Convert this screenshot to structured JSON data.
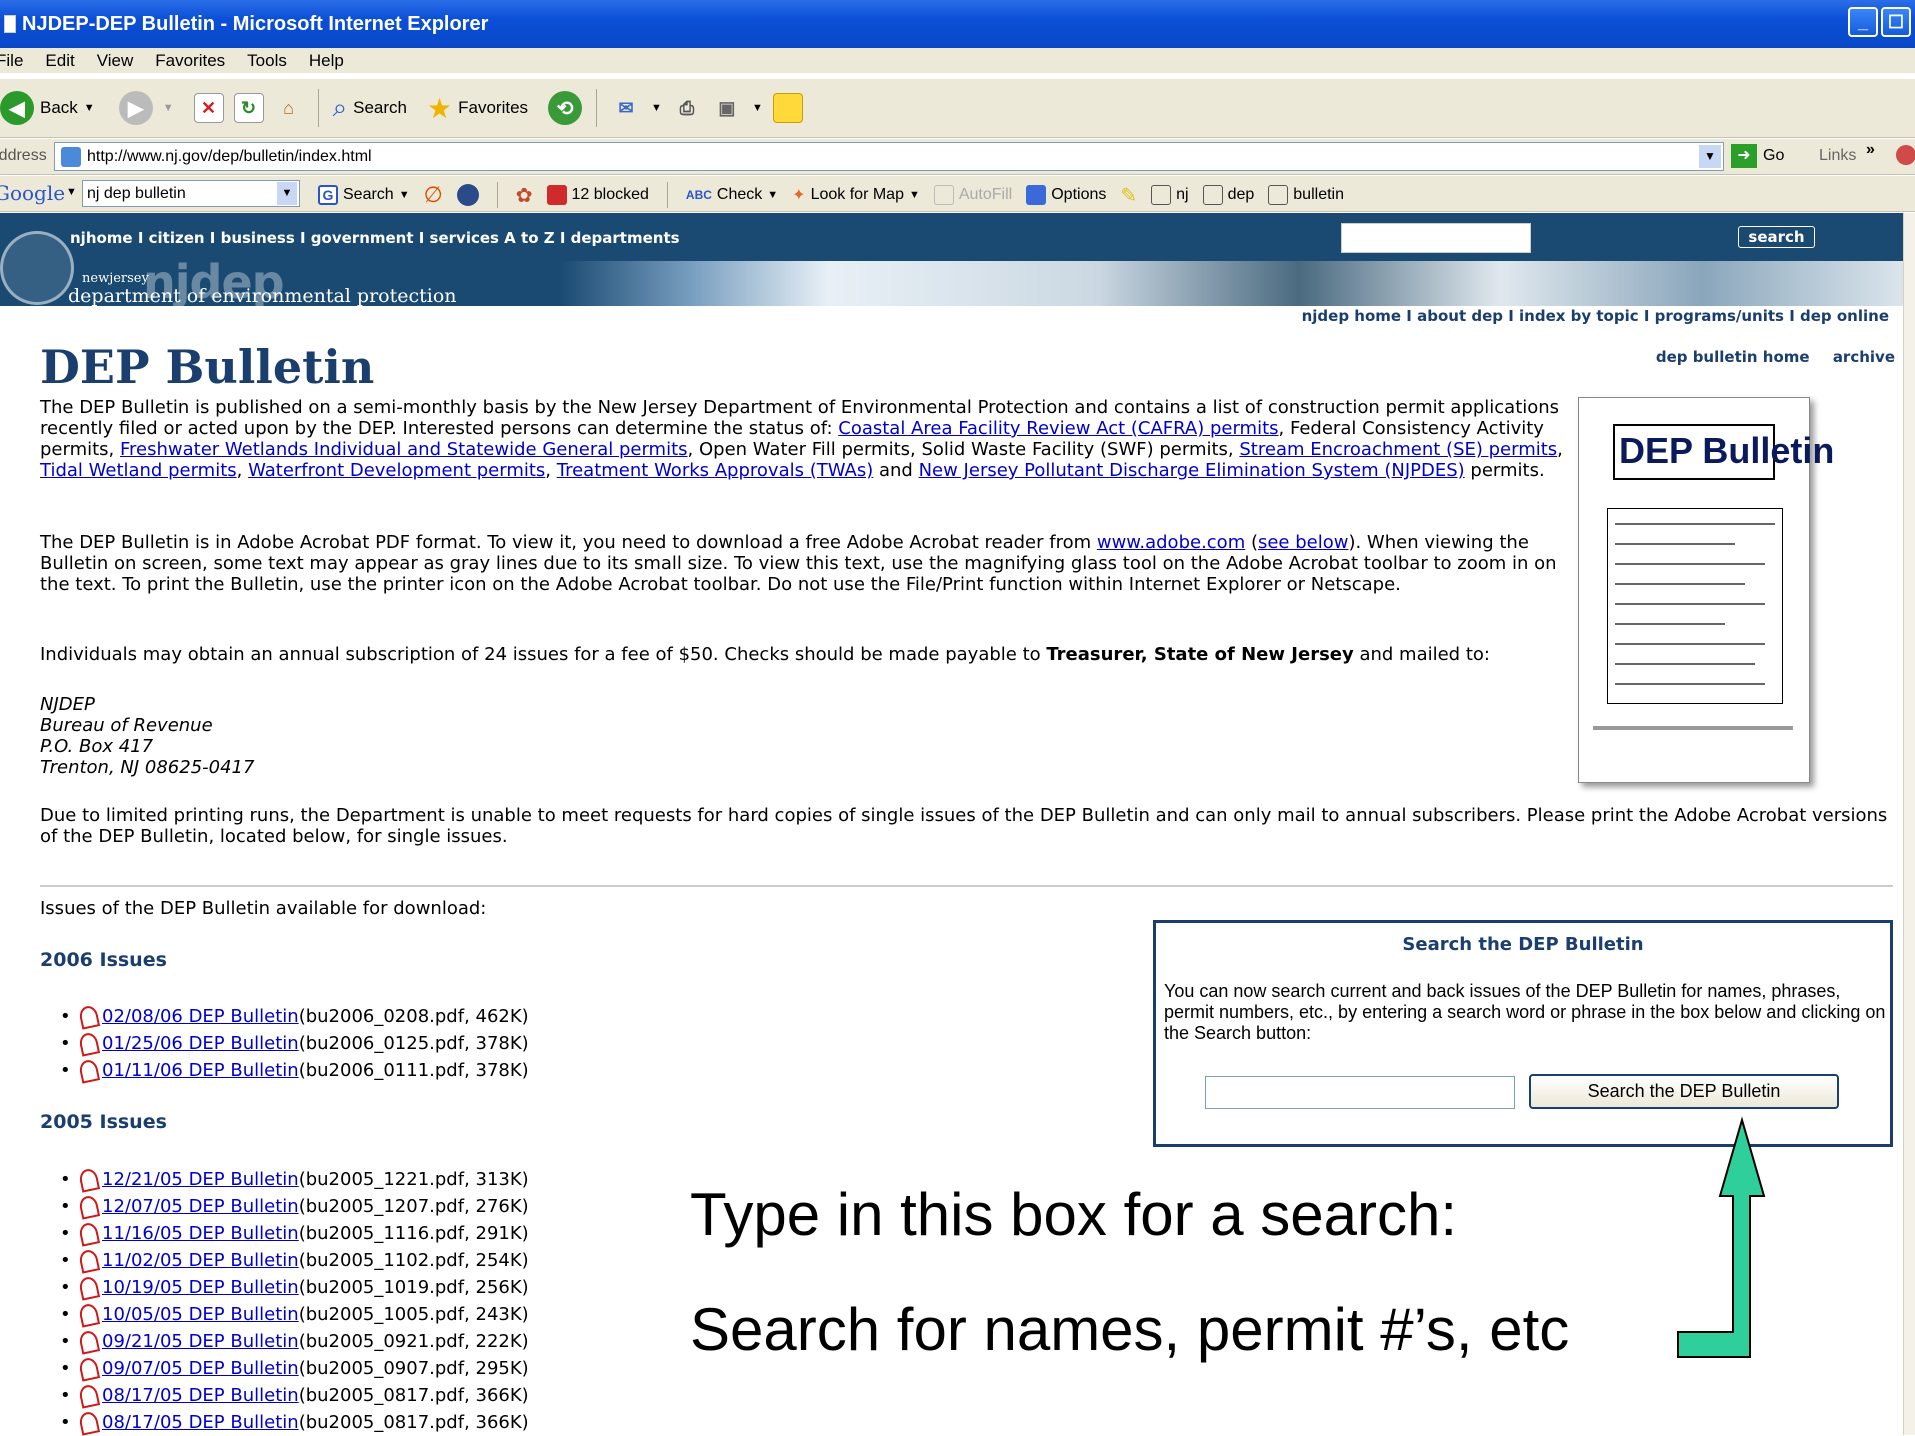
{
  "window": {
    "title": "NJDEP-DEP Bulletin - Microsoft Internet Explorer"
  },
  "menu": [
    "File",
    "Edit",
    "View",
    "Favorites",
    "Tools",
    "Help"
  ],
  "toolbar": {
    "back": "Back",
    "search": "Search",
    "favorites": "Favorites"
  },
  "address": {
    "label": "Address",
    "url": "http://www.nj.gov/dep/bulletin/index.html",
    "go": "Go",
    "links": "Links"
  },
  "google": {
    "logo": "Google",
    "query": "nj dep bulletin",
    "search": "Search",
    "blocked": "12 blocked",
    "check": "Check",
    "lookformap": "Look for Map",
    "autofill": "AutoFill",
    "options": "Options",
    "nj": "nj",
    "dep": "dep",
    "bulletin": "bulletin"
  },
  "njheader": {
    "nav": "njhome  I  citizen  I  business  I  government  I  services A to Z  I  departments",
    "search_btn": "search",
    "newjersey": "newjersey",
    "njdep": "njdep",
    "dept": "department of environmental protection"
  },
  "topnav": "njdep home  I  about dep  I  index by topic  I  programs/units  I  dep online",
  "subnav": {
    "home": "dep bulletin home",
    "archive": "archive"
  },
  "page": {
    "title": "DEP Bulletin",
    "p1_start": "The DEP Bulletin is published on a semi-monthly basis by the New Jersey Department of Environmental Protection and contains a list of construction permit applications recently filed or acted upon by the DEP. Interested persons can determine the status of: ",
    "link_cafra": "Coastal Area Facility Review Act (CAFRA) permits",
    "p1_b": ", Federal Consistency Activity permits, ",
    "link_fw": "Freshwater Wetlands Individual and Statewide General permits",
    "p1_c": ", Open Water Fill permits, Solid Waste Facility (SWF) permits, ",
    "link_se": "Stream Encroachment (SE) permits",
    "comma1": ", ",
    "link_tidal": "Tidal Wetland permits",
    "comma2": ", ",
    "link_wf": "Waterfront Development permits",
    "comma3": ", ",
    "link_twa": "Treatment Works Approvals (TWAs)",
    "and": " and ",
    "link_njpdes": "New Jersey Pollutant Discharge Elimination System (NJPDES)",
    "p1_end": " permits.",
    "p2_start": "The DEP Bulletin is in Adobe Acrobat PDF format. To view it, you need to download a free Adobe Acrobat reader from ",
    "link_adobe": "www.adobe.com",
    "p2_paren": " (",
    "link_below": "see below",
    "p2_end": "). When viewing the Bulletin on screen, some text may appear as gray lines due to its small size. To view this text, use the magnifying glass tool on the Adobe Acrobat toolbar to zoom in on the text. To print the Bulletin, use the printer icon on the Adobe Acrobat toolbar. Do not use the File/Print function within Internet Explorer or Netscape.",
    "p3_start": "Individuals may obtain an annual subscription of 24 issues for a fee of $50. Checks should be made payable to ",
    "p3_bold": "Treasurer, State of New Jersey",
    "p3_end": " and mailed to:",
    "addr1": "NJDEP",
    "addr2": "Bureau of Revenue",
    "addr3": "P.O. Box 417",
    "addr4": "Trenton, NJ 08625-0417",
    "p4": "Due to limited printing runs, the Department is unable to meet requests for hard copies of single issues of the DEP Bulletin and can only mail to annual subscribers. Please print the Adobe Acrobat versions of the DEP Bulletin, located below, for single issues.",
    "issues_intro": "Issues of the DEP Bulletin available for download:",
    "thumb_title": "DEP Bulletin"
  },
  "issues_2006": {
    "heading": "2006 Issues",
    "items": [
      {
        "link": "02/08/06 DEP Bulletin",
        "meta": " (bu2006_0208.pdf, 462K)"
      },
      {
        "link": "01/25/06 DEP Bulletin",
        "meta": " (bu2006_0125.pdf, 378K)"
      },
      {
        "link": "01/11/06 DEP Bulletin",
        "meta": " (bu2006_0111.pdf, 378K)"
      }
    ]
  },
  "issues_2005": {
    "heading": "2005 Issues",
    "items": [
      {
        "link": "12/21/05 DEP Bulletin",
        "meta": " (bu2005_1221.pdf, 313K)"
      },
      {
        "link": "12/07/05 DEP Bulletin",
        "meta": " (bu2005_1207.pdf, 276K)"
      },
      {
        "link": "11/16/05 DEP Bulletin",
        "meta": " (bu2005_1116.pdf, 291K)"
      },
      {
        "link": "11/02/05 DEP Bulletin",
        "meta": " (bu2005_1102.pdf, 254K)"
      },
      {
        "link": "10/19/05 DEP Bulletin",
        "meta": " (bu2005_1019.pdf, 256K)"
      },
      {
        "link": "10/05/05 DEP Bulletin",
        "meta": " (bu2005_1005.pdf, 243K)"
      },
      {
        "link": "09/21/05 DEP Bulletin",
        "meta": " (bu2005_0921.pdf, 222K)"
      },
      {
        "link": "09/07/05 DEP Bulletin",
        "meta": " (bu2005_0907.pdf, 295K)"
      },
      {
        "link": "08/17/05 DEP Bulletin",
        "meta": " (bu2005_0817.pdf, 366K)"
      },
      {
        "link": "08/17/05 DEP Bulletin",
        "meta": " (bu2005_0817.pdf, 366K)"
      }
    ]
  },
  "searchpanel": {
    "title": "Search the DEP Bulletin",
    "text": "You can now search current and back issues of the DEP Bulletin for names, phrases, permit numbers, etc., by entering a search word or phrase in the box below and clicking on the Search button:",
    "button": "Search the DEP Bulletin",
    "input_value": ""
  },
  "annotation": {
    "line1": "Type in this box for a search:",
    "line2": "Search for names, permit #’s, etc",
    "arrow_color": "#2ecf9a"
  }
}
